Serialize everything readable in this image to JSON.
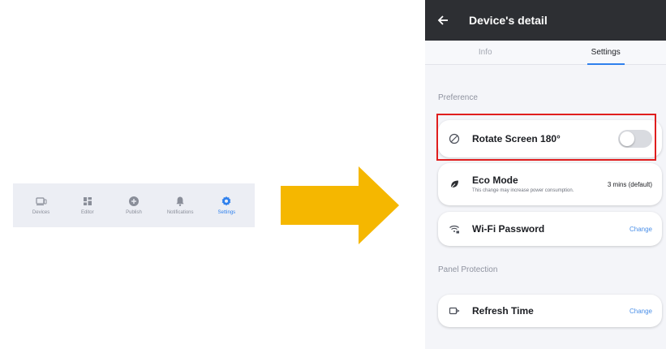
{
  "navbar": {
    "items": [
      {
        "label": "Devices",
        "icon": "devices-icon",
        "active": false
      },
      {
        "label": "Editor",
        "icon": "editor-grid-icon",
        "active": false
      },
      {
        "label": "Publish",
        "icon": "publish-icon",
        "active": false
      },
      {
        "label": "Notifications",
        "icon": "bell-icon",
        "active": false
      },
      {
        "label": "Settings",
        "icon": "gear-icon",
        "active": true
      }
    ],
    "active_color": "#2f80ed"
  },
  "arrow": {
    "color": "#f5b700"
  },
  "screen": {
    "title": "Device's detail",
    "tabs": [
      {
        "label": "Info",
        "active": false
      },
      {
        "label": "Settings",
        "active": true
      }
    ],
    "preference_label": "Preference",
    "rotate": {
      "title": "Rotate Screen 180°",
      "enabled": false,
      "icon": "rotate-icon"
    },
    "eco": {
      "title": "Eco Mode",
      "subtitle": "This change may increase power consumption.",
      "value": "3 mins (default)",
      "icon": "eco-leaf-icon"
    },
    "wifi": {
      "title": "Wi-Fi Password",
      "action": "Change",
      "icon": "wifi-lock-icon"
    },
    "panel_label": "Panel Protection",
    "refresh": {
      "title": "Refresh Time",
      "action": "Change",
      "icon": "refresh-display-icon"
    },
    "highlight_color": "#e01e1e"
  }
}
